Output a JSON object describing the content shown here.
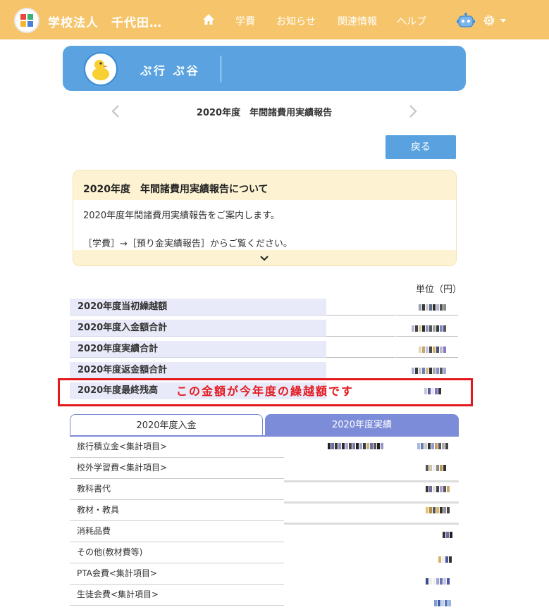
{
  "header": {
    "school_name": "学校法人　千代田…",
    "nav": [
      "学費",
      "お知らせ",
      "関連情報",
      "ヘルプ"
    ]
  },
  "profile": {
    "name": "ぷ行 ぷ谷"
  },
  "report": {
    "title": "2020年度　年間諸費用実績報告",
    "back_label": "戻る"
  },
  "notice": {
    "title": "2020年度　年間諸費用実績報告について",
    "line1": "2020年度年間諸費用実績報告をご案内します。",
    "line2": "［学費］→［預り金実績報告］からご覧ください。"
  },
  "summary": {
    "unit": "単位（円）",
    "rows": [
      "2020年度当初繰越額",
      "2020年度入金額合計",
      "2020年度実績合計",
      "2020年度返金額合計"
    ],
    "final_row": "2020年度最終残高",
    "annotation": "この金額が今年度の繰越額です"
  },
  "tabs": {
    "income": "2020年度入金",
    "results": "2020年度実績"
  },
  "items": [
    "旅行積立金<集計項目>",
    "校外学習費<集計項目>",
    "教科書代",
    "教材・教具",
    "消耗品費",
    "その他(教材費等)",
    "PTA会費<集計項目>",
    "生徒会費<集計項目>"
  ],
  "colors": {
    "header": "#f6c56b",
    "profile": "#5ba3e0",
    "accent": "#7c8cd8",
    "highlight": "#e4191e"
  }
}
